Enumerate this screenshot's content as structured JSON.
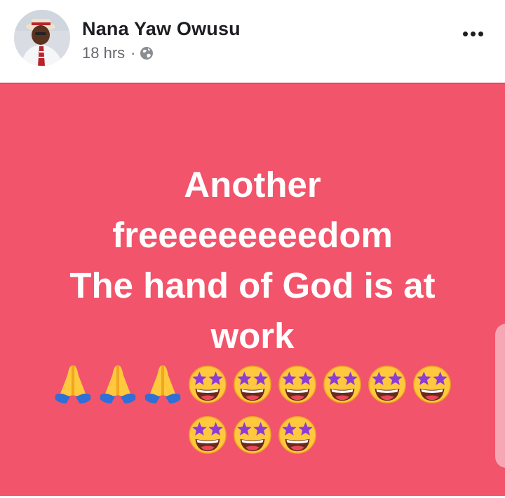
{
  "post": {
    "author_name": "Nana Yaw Owusu",
    "timestamp": "18 hrs",
    "separator": "·",
    "privacy_icon": "globe-icon",
    "more_icon": "more-options-icon",
    "text_lines": [
      "Another",
      "freeeeeeeeedom",
      "The hand of God is at",
      "work"
    ],
    "emoji_row1": [
      "folded-hands",
      "folded-hands",
      "folded-hands",
      "star-struck",
      "star-struck",
      "star-struck",
      "star-struck",
      "star-struck",
      "star-struck"
    ],
    "emoji_row2": [
      "star-struck",
      "star-struck",
      "star-struck"
    ],
    "background_color": "#f2546b"
  }
}
